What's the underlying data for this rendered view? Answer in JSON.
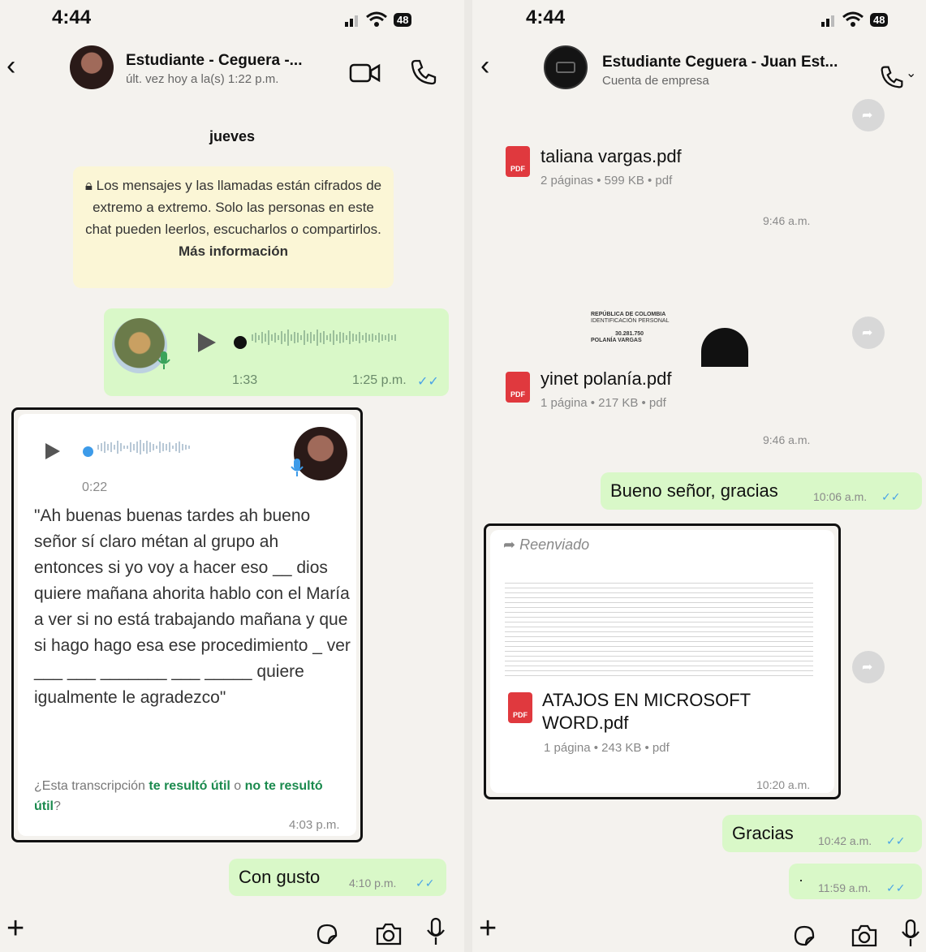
{
  "left": {
    "status": {
      "time": "4:44",
      "battery": "48"
    },
    "header": {
      "name": "Estudiante - Ceguera -...",
      "subtitle": "últ. vez hoy a la(s) 1:22 p.m."
    },
    "date_chip": "jueves",
    "encryption": {
      "text": "Los mensajes y las llamadas están cifrados de extremo a extremo. Solo las personas en este chat pueden leerlos, escucharlos o compartirlos.",
      "link": "Más información"
    },
    "voice_out": {
      "duration": "1:33",
      "time": "1:25 p.m.",
      "ticks": "✓✓"
    },
    "voice_in": {
      "duration": "0:22",
      "transcript": "\"Ah buenas buenas tardes ah bueno señor sí claro métan al grupo ah entonces si yo voy a hacer eso __ dios quiere mañana ahorita hablo con el María a ver si no está trabajando mañana y que si hago hago esa ese procedimiento _ ver ___ ___ _______ ___ _____ quiere igualmente le agradezco\"",
      "feedback_prefix": "¿Esta transcripción",
      "feedback_yes": "te resultó útil",
      "feedback_or": "o",
      "feedback_no": "no te resultó útil",
      "feedback_suffix": "?",
      "time": "4:03 p.m."
    },
    "msg_out": {
      "text": "Con gusto",
      "time": "4:10 p.m.",
      "ticks": "✓✓"
    }
  },
  "right": {
    "status": {
      "time": "4:44",
      "battery": "48"
    },
    "header": {
      "name": "Estudiante Ceguera - Juan Est...",
      "subtitle": "Cuenta de empresa"
    },
    "doc1": {
      "name": "taliana vargas.pdf",
      "meta": "2 páginas • 599 KB • pdf",
      "time": "9:46 a.m."
    },
    "doc2": {
      "name": "yinet polanía.pdf",
      "meta": "1 página • 217 KB • pdf",
      "time": "9:46 a.m.",
      "preview_line1": "REPÚBLICA DE COLOMBIA",
      "preview_line2": "IDENTIFICACIÓN PERSONAL",
      "preview_number": "30.281.750",
      "preview_name": "POLANÍA VARGAS"
    },
    "msg1": {
      "text": "Bueno señor, gracias",
      "time": "10:06 a.m.",
      "ticks": "✓✓"
    },
    "doc3": {
      "forwarded": "Reenviado",
      "name": "ATAJOS EN MICROSOFT WORD.pdf",
      "meta": "1 página • 243 KB • pdf",
      "time": "10:20 a.m."
    },
    "msg2": {
      "text": "Gracias",
      "time": "10:42 a.m.",
      "ticks": "✓✓"
    },
    "msg3": {
      "text": "·",
      "time": "11:59 a.m.",
      "ticks": "✓✓"
    }
  }
}
